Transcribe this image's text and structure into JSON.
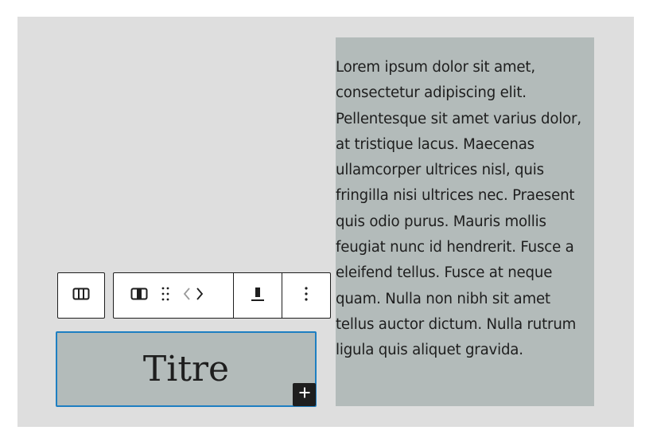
{
  "paragraph": {
    "text": "Lorem ipsum dolor sit amet, consectetur adipiscing elit. Pellentesque sit amet varius dolor, at tristique lacus. Maecenas ullamcorper ultrices nisl, quis fringilla nisi ultrices nec. Praesent quis odio purus. Mauris mollis feugiat nunc id hendrerit. Fusce a eleifend tellus. Fusce at neque quam. Nulla non nibh sit amet tellus auctor dictum. Nulla rutrum ligula quis aliquet gravida."
  },
  "title_block": {
    "text": "Titre"
  },
  "toolbar": {
    "parent_icon": "columns-icon",
    "block_type_icon": "column-icon",
    "drag_icon": "drag-handle-icon",
    "move_icon": "move-left-right-icon",
    "alignment_icon": "vertical-align-bottom-icon",
    "options_icon": "more-vertical-icon"
  },
  "inserter": {
    "icon": "plus-icon"
  },
  "colors": {
    "canvas": "#dedede",
    "column_background": "#b3bbba",
    "selection_border": "#1e7fc2",
    "text": "#1e1e1e"
  }
}
